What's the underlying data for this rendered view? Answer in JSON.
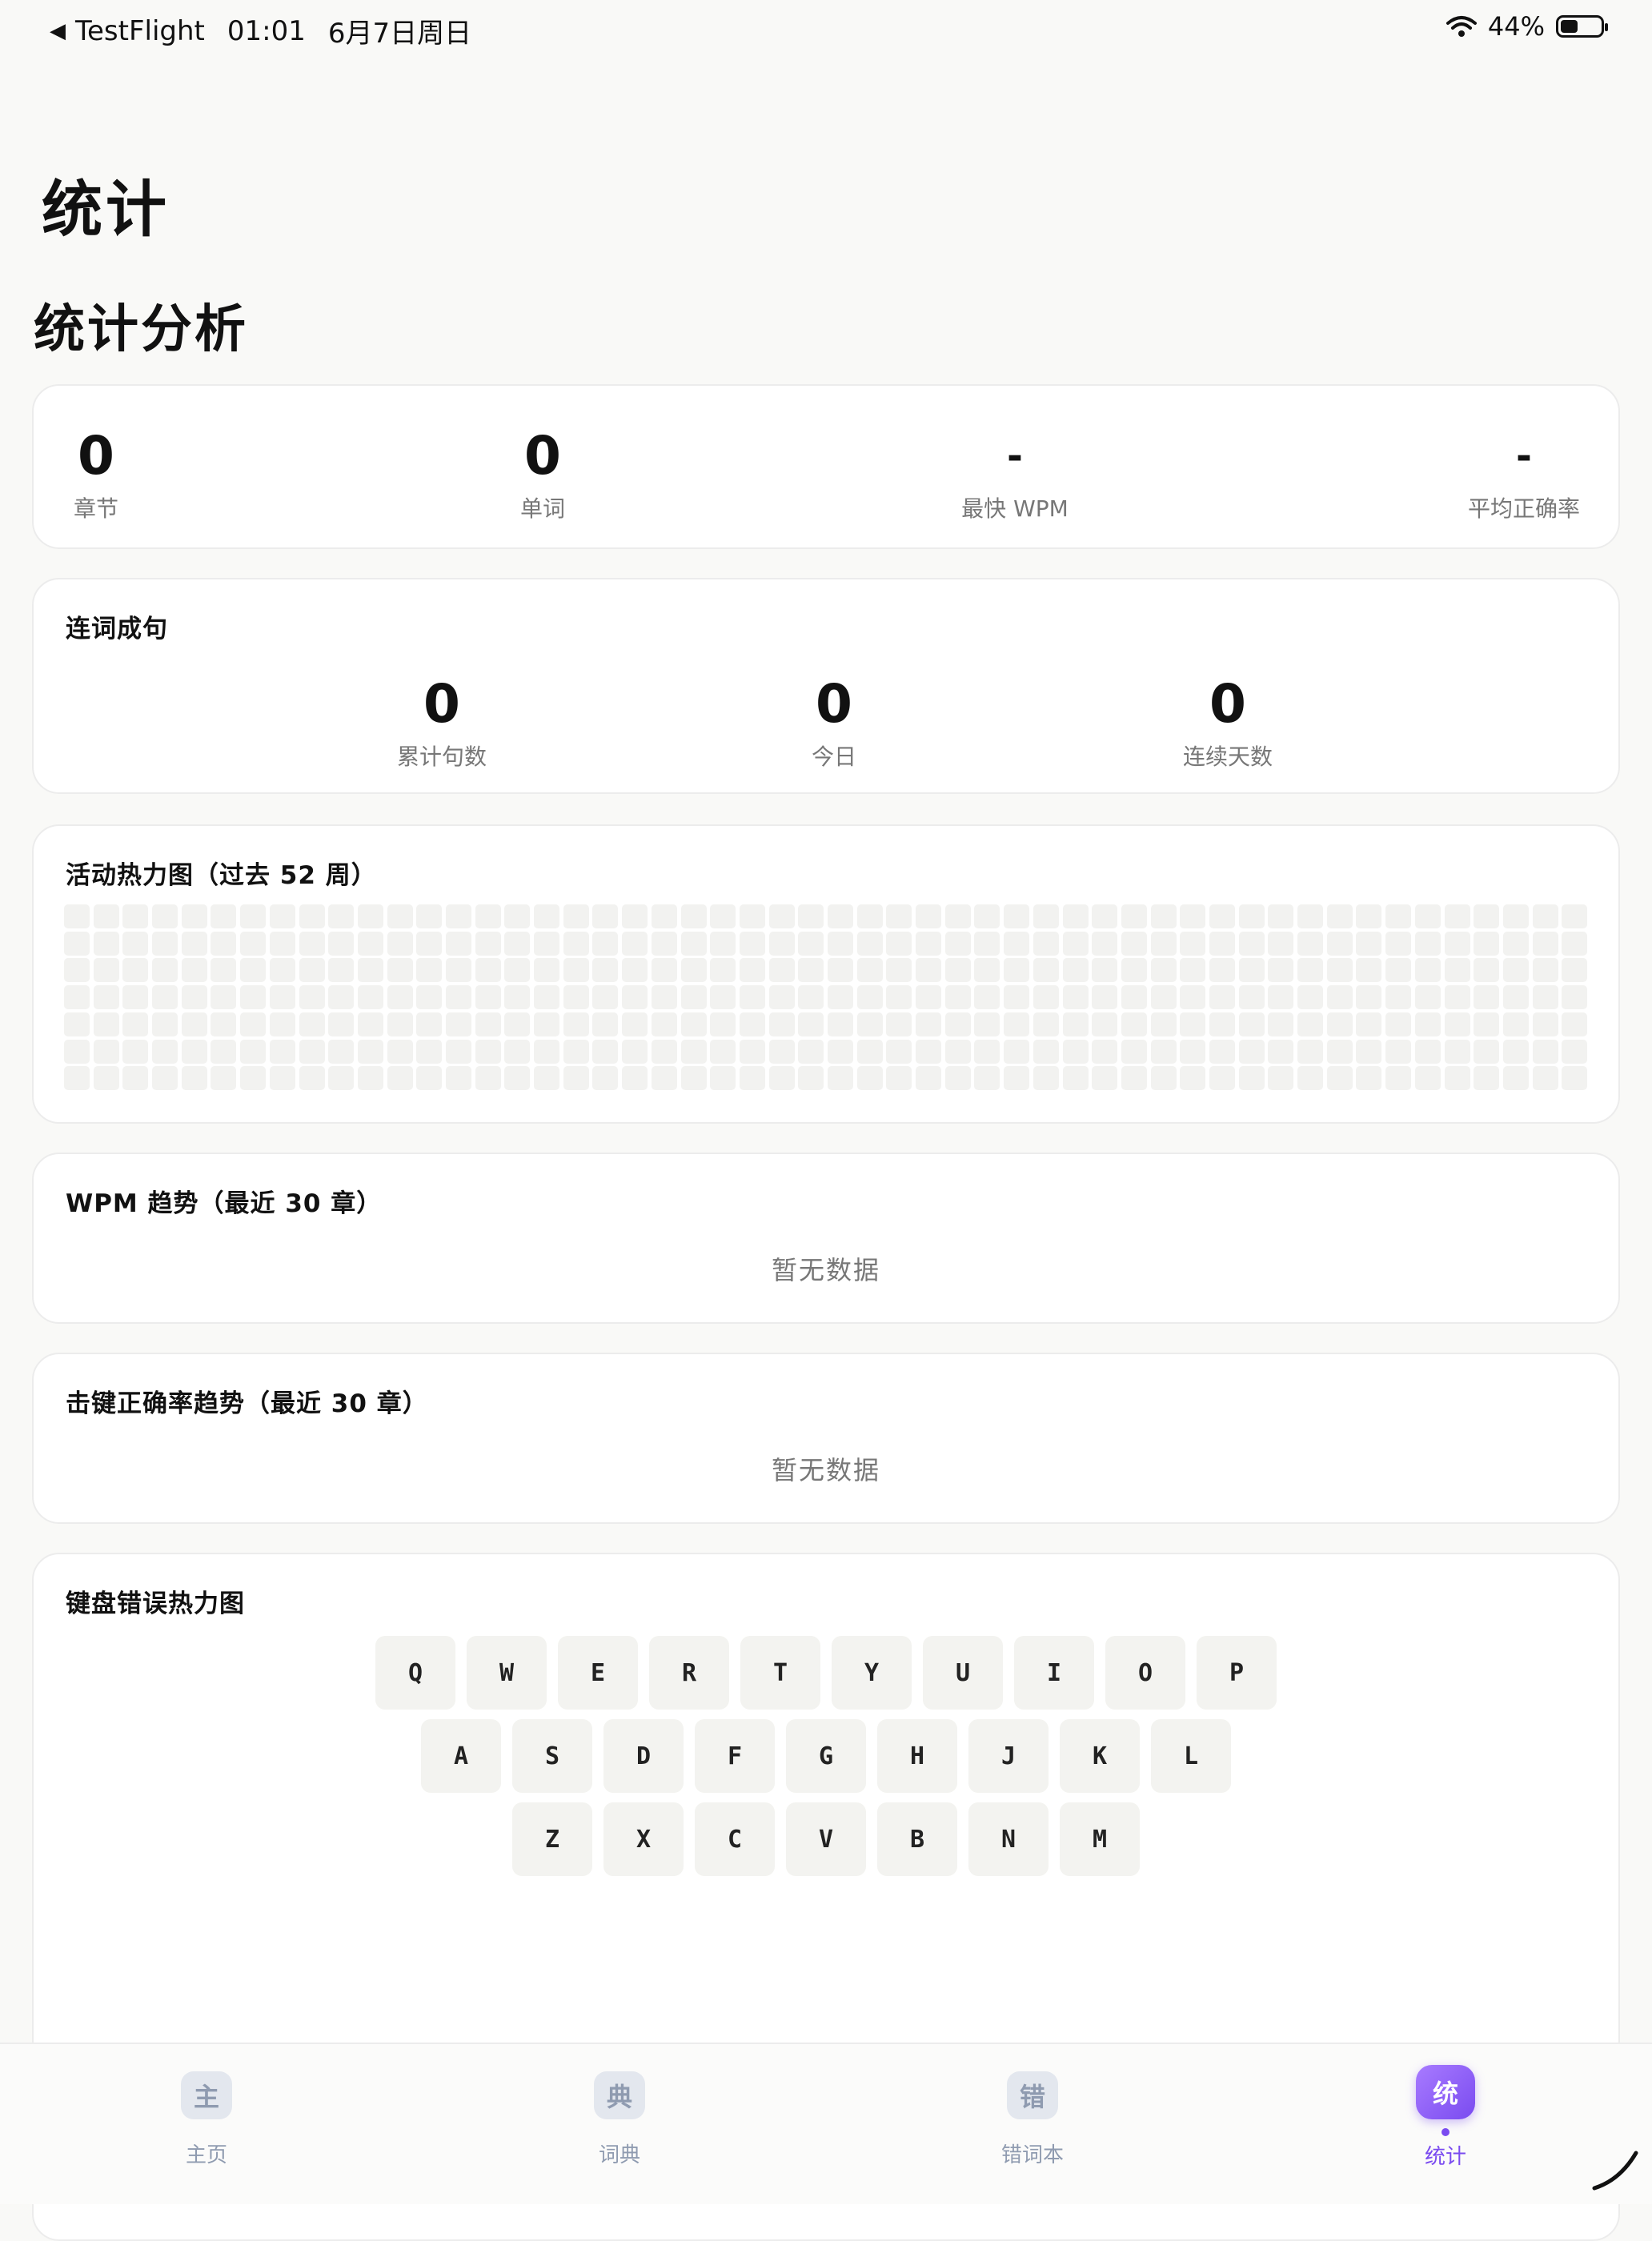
{
  "status_bar": {
    "back_app": "TestFlight",
    "time": "01:01",
    "date": "6月7日周日",
    "battery_percent": "44%",
    "battery_level": 0.44
  },
  "page_title": "统计",
  "section_title": "统计分析",
  "summary": [
    {
      "value": "0",
      "label": "章节"
    },
    {
      "value": "0",
      "label": "单词"
    },
    {
      "value": "-",
      "label": "最快 WPM"
    },
    {
      "value": "-",
      "label": "平均正确率"
    }
  ],
  "sentence_card": {
    "title": "连词成句",
    "stats": [
      {
        "value": "0",
        "label": "累计句数"
      },
      {
        "value": "0",
        "label": "今日"
      },
      {
        "value": "0",
        "label": "连续天数"
      }
    ]
  },
  "activity_heatmap": {
    "title": "活动热力图（过去 52 周）",
    "weeks": 52,
    "days": 7
  },
  "wpm_trend": {
    "title": "WPM 趋势（最近 30 章）",
    "empty_text": "暂无数据"
  },
  "accuracy_trend": {
    "title": "击键正确率趋势（最近 30 章）",
    "empty_text": "暂无数据"
  },
  "keyboard_heatmap": {
    "title": "键盘错误热力图",
    "rows": [
      [
        "Q",
        "W",
        "E",
        "R",
        "T",
        "Y",
        "U",
        "I",
        "O",
        "P"
      ],
      [
        "A",
        "S",
        "D",
        "F",
        "G",
        "H",
        "J",
        "K",
        "L"
      ],
      [
        "Z",
        "X",
        "C",
        "V",
        "B",
        "N",
        "M"
      ]
    ]
  },
  "tabs": [
    {
      "icon": "主",
      "label": "主页",
      "active": false
    },
    {
      "icon": "典",
      "label": "词典",
      "active": false
    },
    {
      "icon": "错",
      "label": "错词本",
      "active": false
    },
    {
      "icon": "统",
      "label": "统计",
      "active": true
    }
  ]
}
